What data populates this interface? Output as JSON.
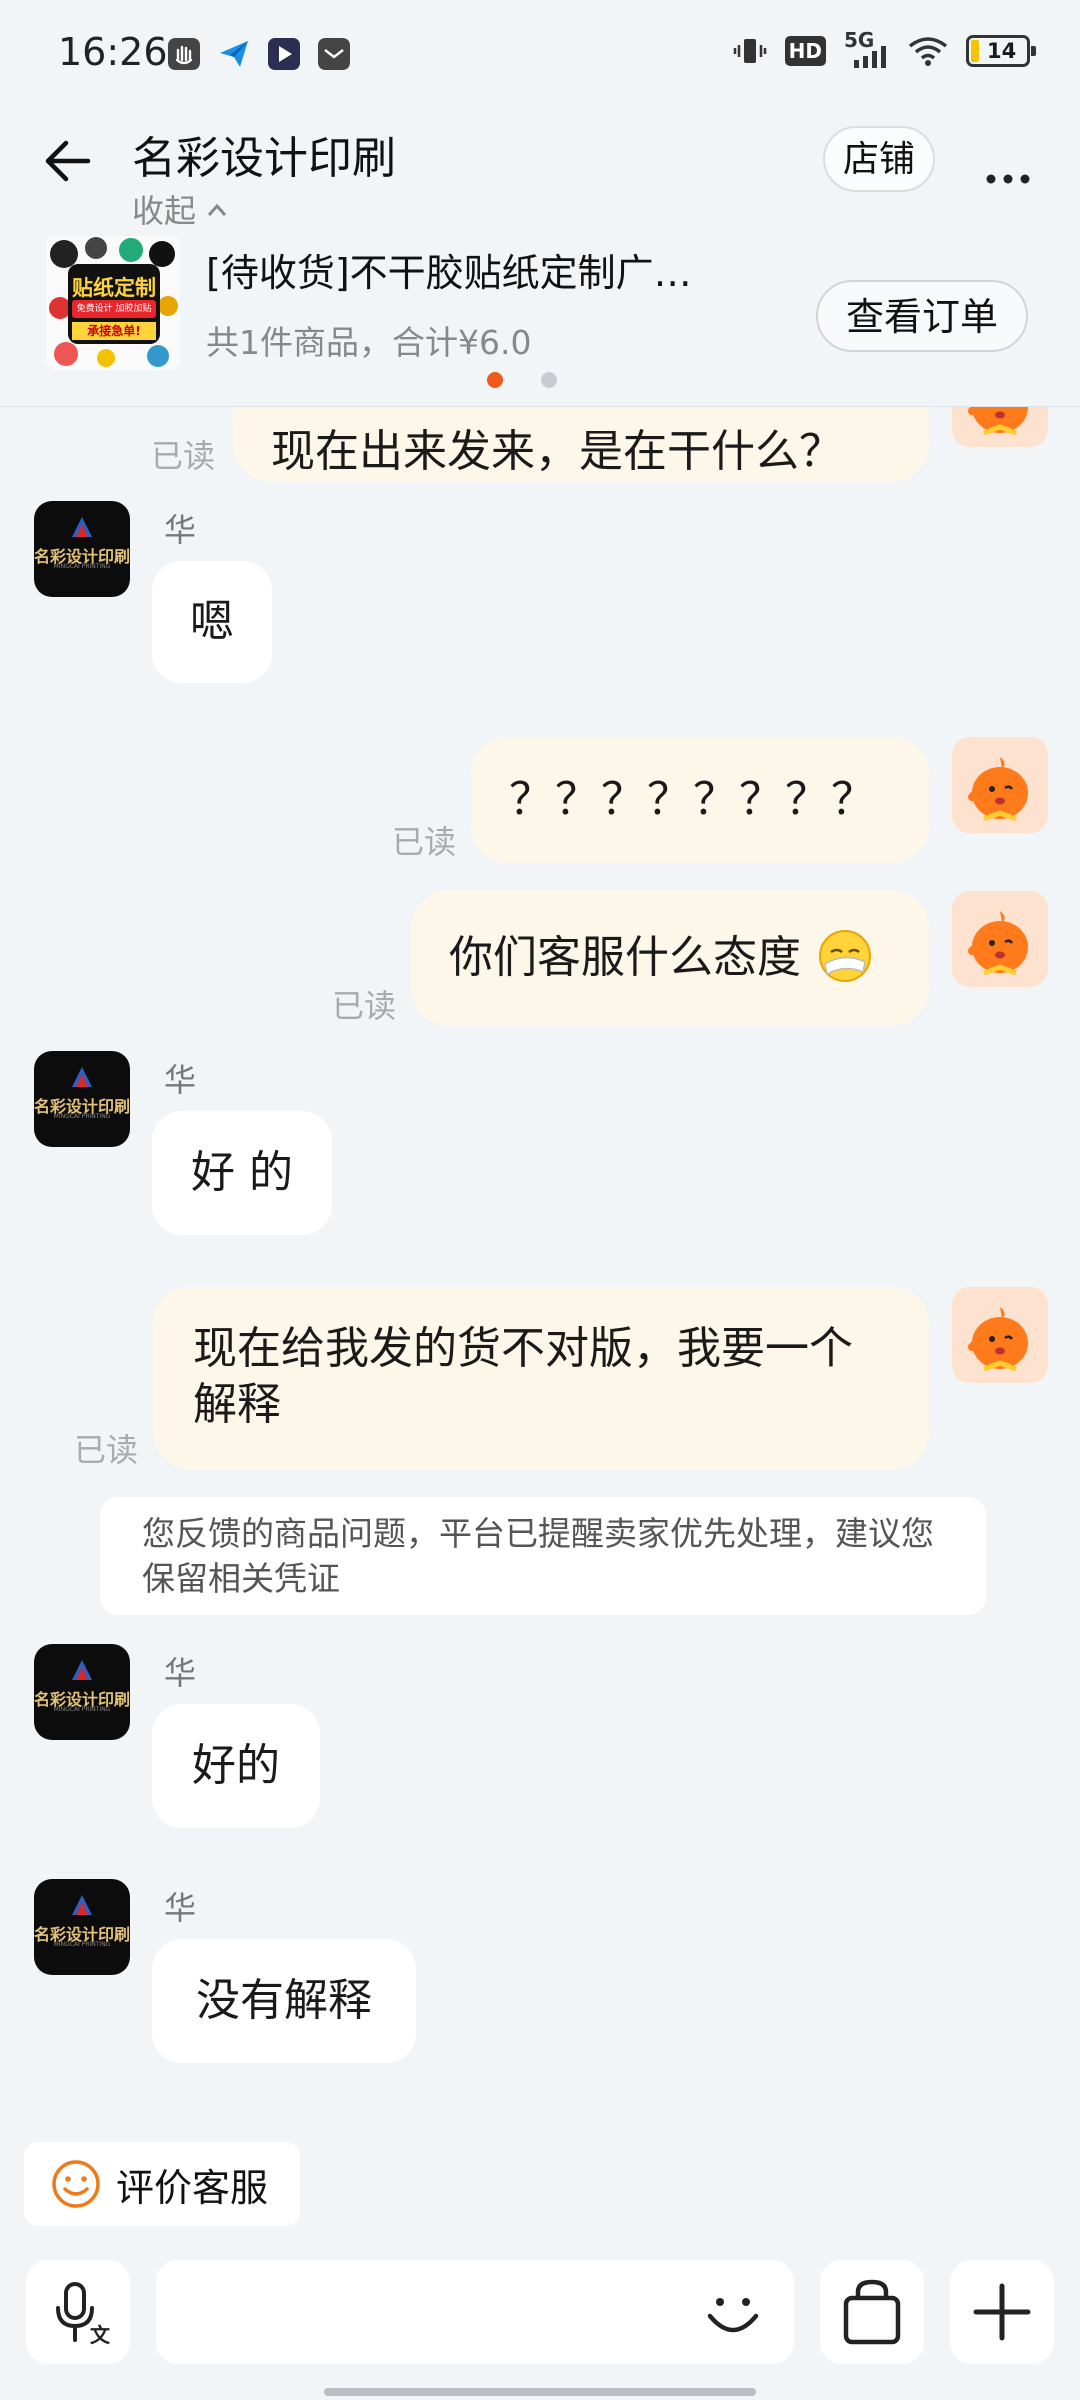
{
  "status_bar": {
    "time": "16:26",
    "battery": "14",
    "network": "5G",
    "hd": "HD"
  },
  "header": {
    "shop_name": "名彩设计印刷",
    "collapse_label": "收起",
    "store_button": "店铺",
    "more_icon": "more-dots-icon"
  },
  "order": {
    "title": "[待收货]不干胶贴纸定制广…",
    "summary": "共1件商品，合计¥6.0",
    "view_button": "查看订单",
    "thumb_text": {
      "top": "贴纸定制",
      "mid": "免费设计 加胶加贴",
      "bottom": "承接急单!"
    },
    "dots": {
      "active": "#f05a1a",
      "inactive": "#c9cdd1"
    }
  },
  "messages": {
    "m0_text": "现在出来发来，是在干什么？",
    "read_label": "已读",
    "seller_name": "华",
    "shop_avatar_text": "名彩设计印刷",
    "shop_avatar_sub": "MINGCAI PRINTING",
    "m1_text": "嗯",
    "m2_text": "？？？？？？？？",
    "m3_text": "你们客服什么态度",
    "m4_text": "好 的",
    "m5_text": "现在给我发的货不对版，我要一个解释",
    "system_note": "您反馈的商品问题，平台已提醒卖家优先处理，建议您保留相关凭证",
    "m6_text": "好的",
    "m7_text": "没有解释"
  },
  "bottom": {
    "rate_label": "评价客服",
    "icons": [
      "voice-to-text-icon",
      "emoji-icon",
      "shopping-bag-icon",
      "plus-icon"
    ]
  },
  "colors": {
    "accent": "#f05a1a",
    "my_bubble": "#fdf7e9",
    "background": "#f1f5f8"
  }
}
